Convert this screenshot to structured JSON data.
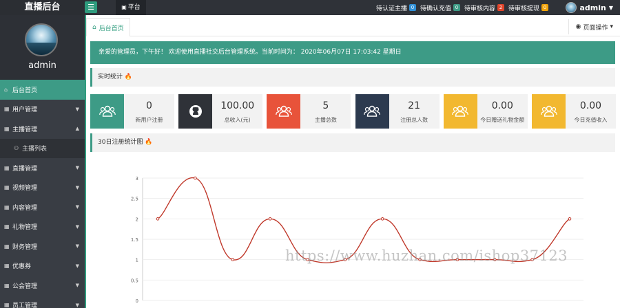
{
  "header": {
    "brand": "直播后台",
    "menu_toggle": "☰",
    "tab_label": "平台",
    "alerts": [
      {
        "label": "待认证主播",
        "count": "0",
        "color": "#2f8fd6"
      },
      {
        "label": "待确认充值",
        "count": "0",
        "color": "#3d9b86"
      },
      {
        "label": "待审核内容",
        "count": "2",
        "color": "#e0442a"
      },
      {
        "label": "待审核提现",
        "count": "0",
        "color": "#f0a30a"
      }
    ],
    "user": "admin"
  },
  "sidebar": {
    "profile_name": "admin",
    "items": [
      {
        "label": "后台首页",
        "icon": "home-icon",
        "glyph": "⌂",
        "active": true
      },
      {
        "label": "用户管理",
        "icon": "user-icon",
        "glyph": "▦",
        "arrow": "▼"
      },
      {
        "label": "主播管理",
        "icon": "anchor-icon",
        "glyph": "▦",
        "arrow": "▲"
      },
      {
        "label": "主播列表",
        "icon": "list-icon",
        "glyph": "⚇",
        "sub": true
      },
      {
        "label": "直播管理",
        "icon": "live-icon",
        "glyph": "▦",
        "arrow": "▼"
      },
      {
        "label": "视频管理",
        "icon": "video-icon",
        "glyph": "▦",
        "arrow": "▼"
      },
      {
        "label": "内容管理",
        "icon": "content-icon",
        "glyph": "▦",
        "arrow": "▼"
      },
      {
        "label": "礼物管理",
        "icon": "gift-icon",
        "glyph": "▦",
        "arrow": "▼"
      },
      {
        "label": "财务管理",
        "icon": "finance-icon",
        "glyph": "▦",
        "arrow": "▼"
      },
      {
        "label": "优惠券",
        "icon": "coupon-icon",
        "glyph": "▦",
        "arrow": "▼"
      },
      {
        "label": "公会管理",
        "icon": "guild-icon",
        "glyph": "▦",
        "arrow": "▼"
      },
      {
        "label": "员工管理",
        "icon": "staff-icon",
        "glyph": "▦",
        "arrow": "▼"
      }
    ]
  },
  "main": {
    "tab": "后台首页",
    "page_ops": "页面操作",
    "welcome": "亲爱的管理员，下午好！ 欢迎使用直播社交后台管理系统。当前时间为： 2020年06月07日 17:03:42   星期日",
    "realtime_title": "实时统计",
    "stats": [
      {
        "value": "0",
        "label": "新用户注册",
        "color": "#3d9b86",
        "icon": "users-icon",
        "glyph": "👥"
      },
      {
        "value": "100.00",
        "label": "总收入(元)",
        "color": "#2f3238",
        "icon": "github-icon",
        "glyph": "🐱"
      },
      {
        "value": "5",
        "label": "主播总数",
        "color": "#e8533a",
        "icon": "users-icon",
        "glyph": "👥"
      },
      {
        "value": "21",
        "label": "注册总人数",
        "color": "#2c3a4f",
        "icon": "users-icon",
        "glyph": "👥"
      },
      {
        "value": "0.00",
        "label": "今日赠送礼物金额",
        "color": "#f2b830",
        "icon": "users-icon",
        "glyph": "👥"
      },
      {
        "value": "0.00",
        "label": "今日充值收入",
        "color": "#f2b830",
        "icon": "users-icon",
        "glyph": "👥"
      }
    ],
    "chart_title": "30日注册统计图"
  },
  "watermark": "https://www.huzhan.com/ishop37123",
  "chart_data": {
    "type": "line",
    "ylim": [
      0,
      3
    ],
    "yticks": [
      "0",
      "0.5",
      "1",
      "1.5",
      "2",
      "2.5",
      "3"
    ],
    "series": [
      {
        "values": [
          2,
          3,
          1,
          2,
          1,
          1,
          2,
          1,
          1,
          1,
          1,
          2
        ],
        "color": "#c0392b"
      }
    ],
    "smooth": true,
    "grid": true
  }
}
